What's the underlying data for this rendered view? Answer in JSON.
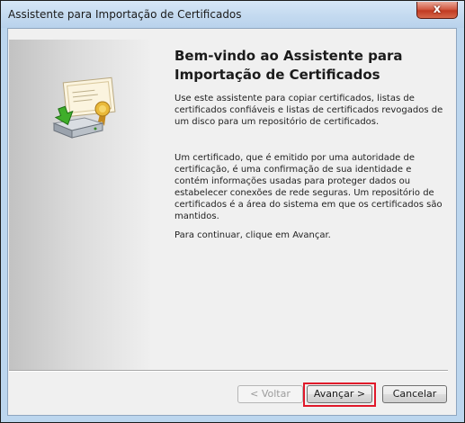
{
  "window": {
    "title": "Assistente para Importação de Certificados",
    "close_label": "x"
  },
  "wizard": {
    "heading": "Bem-vindo ao Assistente para Importação de Certificados",
    "paragraphs": [
      "Use este assistente para copiar certificados, listas de certificados confiáveis e listas de certificados revogados de um disco para um repositório de certificados.",
      "Um certificado, que é emitido por uma autoridade de certificação, é uma confirmação de sua identidade e contém informações usadas para proteger dados ou estabelecer conexões de rede seguras. Um repositório de certificados é a área do sistema em que os certificados são mantidos.",
      "Para continuar, clique em Avançar."
    ],
    "image": "certificate-import-icon"
  },
  "buttons": {
    "back": "< Voltar",
    "next": "Avançar >",
    "cancel": "Cancelar"
  },
  "colors": {
    "highlight": "#e0182a",
    "title_bar": "#c4daf0",
    "close_button": "#c13a22"
  }
}
